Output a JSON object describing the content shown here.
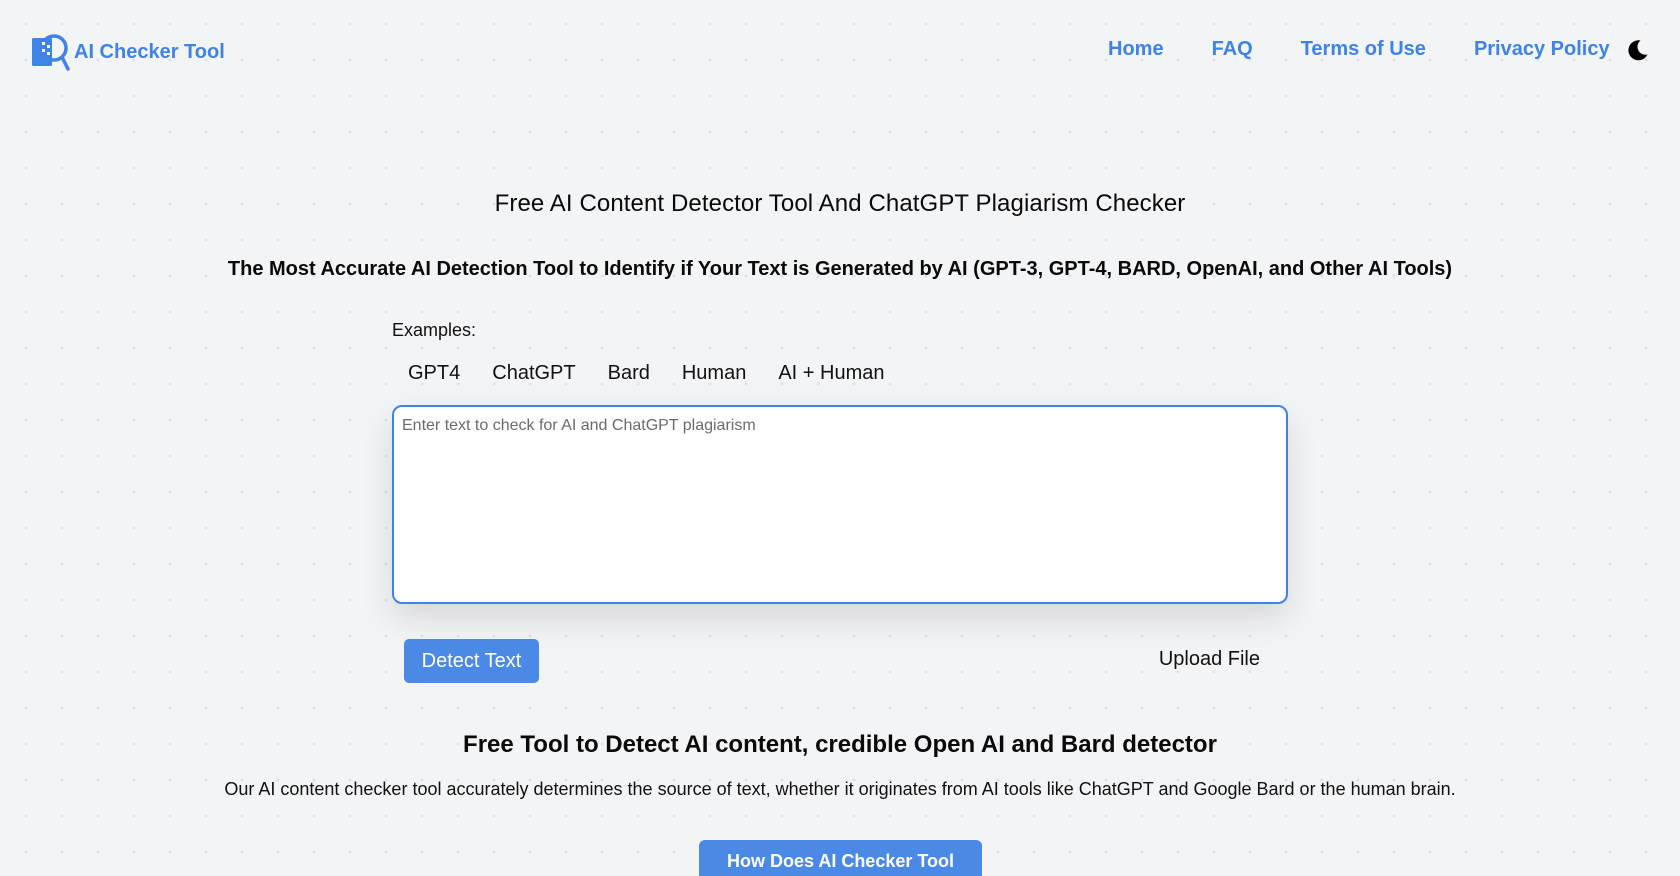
{
  "header": {
    "brand": "AI Checker Tool",
    "nav": [
      "Home",
      "FAQ",
      "Terms of Use",
      "Privacy Policy"
    ],
    "theme_icon": "moon-icon"
  },
  "colors": {
    "accent": "#3f83e6",
    "button": "#4a8ae6",
    "background": "#f3f4f6"
  },
  "main": {
    "title": "Free AI Content Detector Tool And ChatGPT Plagiarism Checker",
    "subtitle": "The Most Accurate AI Detection Tool to Identify if Your Text is Generated by AI (GPT-3, GPT-4, BARD, OpenAI, and Other AI Tools)",
    "examples_label": "Examples:",
    "examples": [
      "GPT4",
      "ChatGPT",
      "Bard",
      "Human",
      "AI + Human"
    ],
    "input_placeholder": "Enter text to check for AI and ChatGPT plagiarism",
    "input_value": "",
    "detect_label": "Detect Text",
    "upload_label": "Upload File",
    "section_title": "Free Tool to Detect AI content, credible Open AI and Bard detector",
    "section_desc": "Our AI content checker tool accurately determines the source of text, whether it originates from AI tools like ChatGPT and Google Bard or the human brain.",
    "how_label": "How Does AI Checker Tool Work?"
  }
}
